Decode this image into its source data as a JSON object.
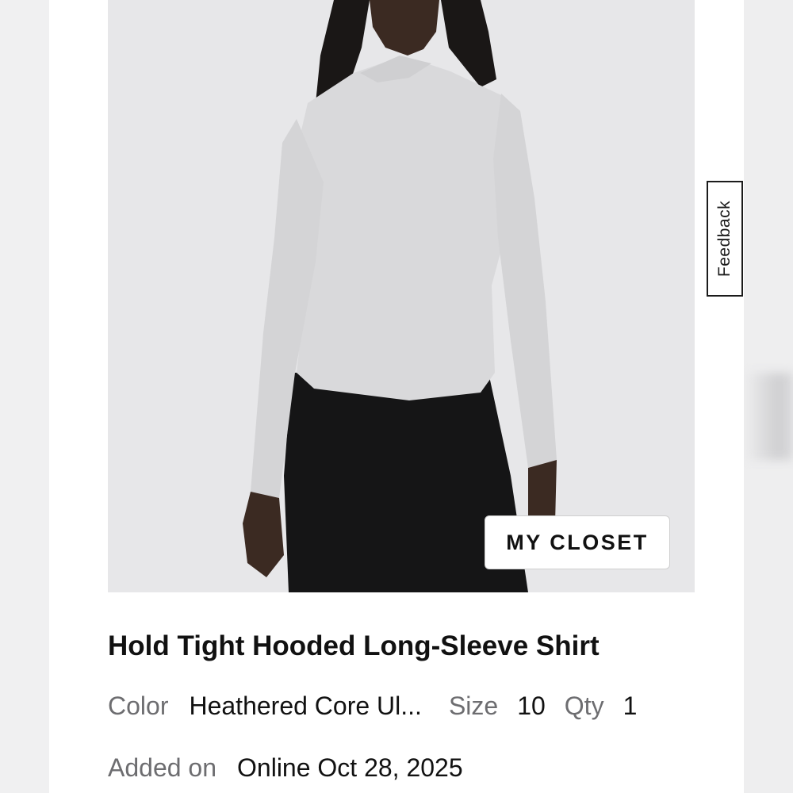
{
  "product": {
    "badge_label": "MY CLOSET",
    "title": "Hold Tight Hooded Long-Sleeve Shirt",
    "color_label": "Color",
    "color_value": "Heathered Core Ul...",
    "size_label": "Size",
    "size_value": "10",
    "qty_label": "Qty",
    "qty_value": "1",
    "added_label": "Added on",
    "added_value": "Online Oct 28, 2025"
  },
  "feedback": {
    "label": "Feedback"
  },
  "colors": {
    "image_bg": "#e7e7e9",
    "shirt": "#d9d9db",
    "pants": "#151516"
  }
}
